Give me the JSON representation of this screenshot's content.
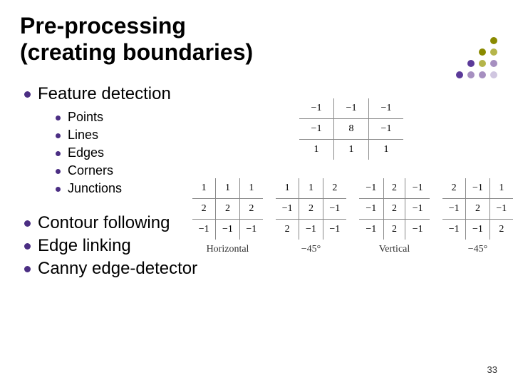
{
  "title_line1": "Pre-processing",
  "title_line2": "(creating boundaries)",
  "bullets": {
    "feature_detection": "Feature detection",
    "sub": [
      "Points",
      "Lines",
      "Edges",
      "Corners",
      "Junctions"
    ],
    "contour": "Contour following",
    "edge_linking": "Edge linking",
    "canny": "Canny edge-detector"
  },
  "page_number": "33",
  "deco_pattern": [
    "c0",
    "c0",
    "c0",
    "c0",
    "c1",
    "c0",
    "c0",
    "c0",
    "c1",
    "c2",
    "c0",
    "c0",
    "c3",
    "c2",
    "c4",
    "c0",
    "c3",
    "c4",
    "c4",
    "c5"
  ],
  "chart_data": [
    {
      "type": "table",
      "name": "point_kernel",
      "values": [
        [
          "−1",
          "−1",
          "−1"
        ],
        [
          "−1",
          "8",
          "−1"
        ],
        [
          "1",
          "1",
          "1"
        ]
      ],
      "title": ""
    },
    {
      "type": "table",
      "name": "horizontal",
      "values": [
        [
          "1",
          "1",
          "1"
        ],
        [
          "2",
          "2",
          "2"
        ],
        [
          "−1",
          "−1",
          "−1"
        ]
      ],
      "title": "Horizontal"
    },
    {
      "type": "table",
      "name": "neg45",
      "values": [
        [
          "1",
          "1",
          "2"
        ],
        [
          "−1",
          "2",
          "−1"
        ],
        [
          "2",
          "−1",
          "−1"
        ]
      ],
      "title": "−45°"
    },
    {
      "type": "table",
      "name": "vertical",
      "values": [
        [
          "−1",
          "2",
          "−1"
        ],
        [
          "−1",
          "2",
          "−1"
        ],
        [
          "−1",
          "2",
          "−1"
        ]
      ],
      "title": "Vertical"
    },
    {
      "type": "table",
      "name": "pos45_mirror",
      "values": [
        [
          "2",
          "−1",
          "1"
        ],
        [
          "−1",
          "2",
          "−1"
        ],
        [
          "−1",
          "−1",
          "2"
        ]
      ],
      "title": "−45°"
    }
  ]
}
